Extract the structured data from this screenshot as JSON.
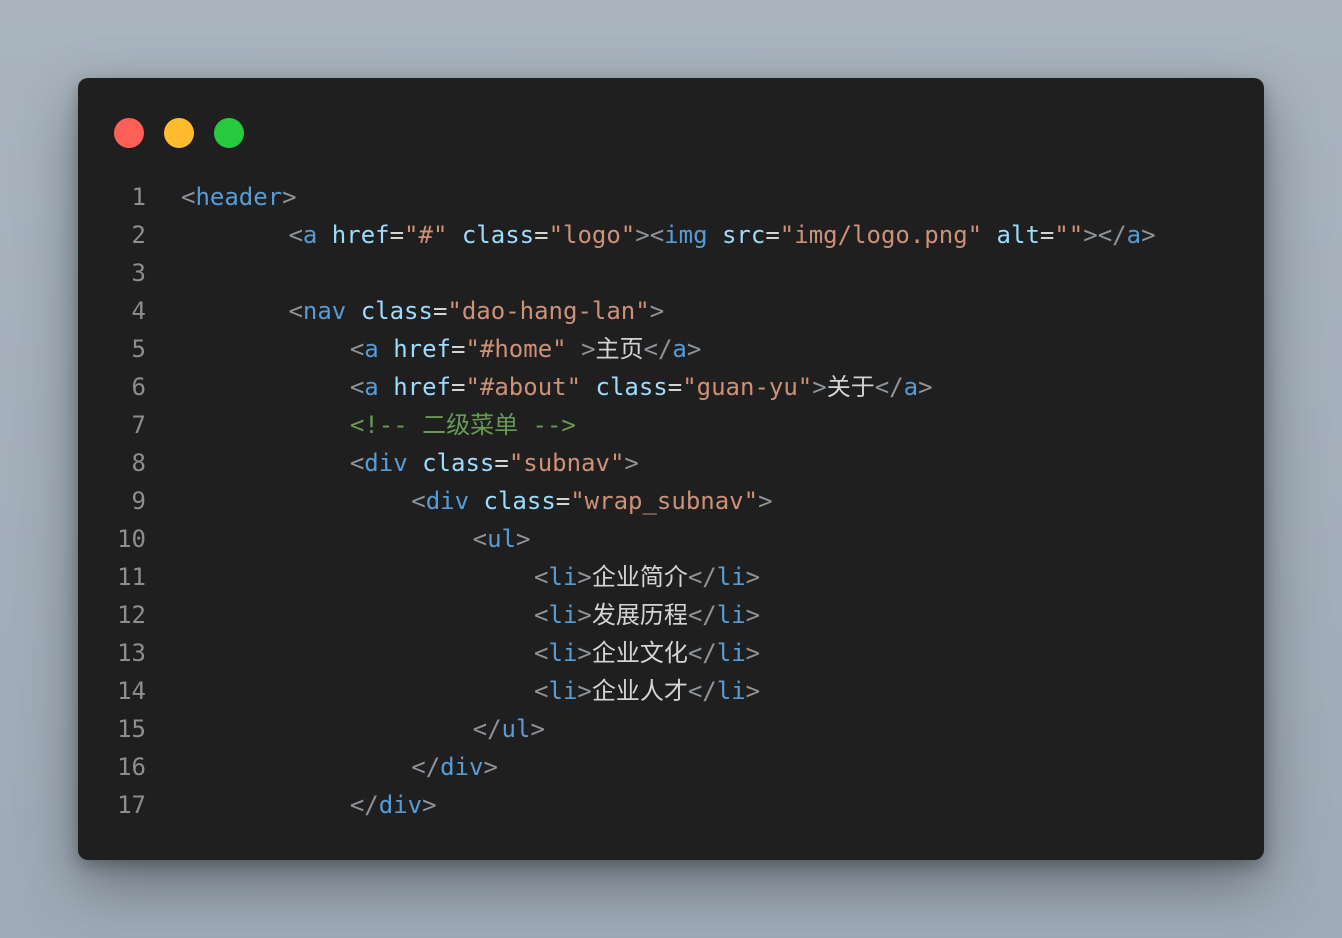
{
  "window_controls": [
    {
      "name": "close",
      "color": "#ff5f56"
    },
    {
      "name": "minimize",
      "color": "#ffbd2e"
    },
    {
      "name": "maximize",
      "color": "#27c93f"
    }
  ],
  "colors": {
    "bracket": "#8e9499",
    "tag": "#569cd6",
    "attr": "#9cdcfe",
    "string": "#ce9178",
    "text": "#d4d4d4",
    "comment": "#6a9955"
  },
  "code": {
    "lines": [
      {
        "n": "1",
        "indent": 0,
        "tokens": [
          {
            "t": "<",
            "k": "bracket"
          },
          {
            "t": "header",
            "k": "tag"
          },
          {
            "t": ">",
            "k": "bracket"
          }
        ]
      },
      {
        "n": "2",
        "indent": 7,
        "tokens": [
          {
            "t": "<",
            "k": "bracket"
          },
          {
            "t": "a",
            "k": "tag"
          },
          {
            "t": " ",
            "k": "text"
          },
          {
            "t": "href",
            "k": "attr"
          },
          {
            "t": "=",
            "k": "text"
          },
          {
            "t": "\"#\"",
            "k": "string"
          },
          {
            "t": " ",
            "k": "text"
          },
          {
            "t": "class",
            "k": "attr"
          },
          {
            "t": "=",
            "k": "text"
          },
          {
            "t": "\"logo\"",
            "k": "string"
          },
          {
            "t": "><",
            "k": "bracket"
          },
          {
            "t": "img",
            "k": "tag"
          },
          {
            "t": " ",
            "k": "text"
          },
          {
            "t": "src",
            "k": "attr"
          },
          {
            "t": "=",
            "k": "text"
          },
          {
            "t": "\"img/logo.png\"",
            "k": "string"
          },
          {
            "t": " ",
            "k": "text"
          },
          {
            "t": "alt",
            "k": "attr"
          },
          {
            "t": "=",
            "k": "text"
          },
          {
            "t": "\"\"",
            "k": "string"
          },
          {
            "t": "></",
            "k": "bracket"
          },
          {
            "t": "a",
            "k": "tag"
          },
          {
            "t": ">",
            "k": "bracket"
          }
        ]
      },
      {
        "n": "3",
        "indent": 0,
        "tokens": []
      },
      {
        "n": "4",
        "indent": 7,
        "tokens": [
          {
            "t": "<",
            "k": "bracket"
          },
          {
            "t": "nav",
            "k": "tag"
          },
          {
            "t": " ",
            "k": "text"
          },
          {
            "t": "class",
            "k": "attr"
          },
          {
            "t": "=",
            "k": "text"
          },
          {
            "t": "\"dao-hang-lan\"",
            "k": "string"
          },
          {
            "t": ">",
            "k": "bracket"
          }
        ]
      },
      {
        "n": "5",
        "indent": 11,
        "tokens": [
          {
            "t": "<",
            "k": "bracket"
          },
          {
            "t": "a",
            "k": "tag"
          },
          {
            "t": " ",
            "k": "text"
          },
          {
            "t": "href",
            "k": "attr"
          },
          {
            "t": "=",
            "k": "text"
          },
          {
            "t": "\"#home\"",
            "k": "string"
          },
          {
            "t": " ",
            "k": "text"
          },
          {
            "t": ">",
            "k": "bracket"
          },
          {
            "t": "主页",
            "k": "text"
          },
          {
            "t": "</",
            "k": "bracket"
          },
          {
            "t": "a",
            "k": "tag"
          },
          {
            "t": ">",
            "k": "bracket"
          }
        ]
      },
      {
        "n": "6",
        "indent": 11,
        "tokens": [
          {
            "t": "<",
            "k": "bracket"
          },
          {
            "t": "a",
            "k": "tag"
          },
          {
            "t": " ",
            "k": "text"
          },
          {
            "t": "href",
            "k": "attr"
          },
          {
            "t": "=",
            "k": "text"
          },
          {
            "t": "\"#about\"",
            "k": "string"
          },
          {
            "t": " ",
            "k": "text"
          },
          {
            "t": "class",
            "k": "attr"
          },
          {
            "t": "=",
            "k": "text"
          },
          {
            "t": "\"guan-yu\"",
            "k": "string"
          },
          {
            "t": ">",
            "k": "bracket"
          },
          {
            "t": "关于",
            "k": "text"
          },
          {
            "t": "</",
            "k": "bracket"
          },
          {
            "t": "a",
            "k": "tag"
          },
          {
            "t": ">",
            "k": "bracket"
          }
        ]
      },
      {
        "n": "7",
        "indent": 11,
        "tokens": [
          {
            "t": "<!-- 二级菜单 -->",
            "k": "comment"
          }
        ]
      },
      {
        "n": "8",
        "indent": 11,
        "tokens": [
          {
            "t": "<",
            "k": "bracket"
          },
          {
            "t": "div",
            "k": "tag"
          },
          {
            "t": " ",
            "k": "text"
          },
          {
            "t": "class",
            "k": "attr"
          },
          {
            "t": "=",
            "k": "text"
          },
          {
            "t": "\"subnav\"",
            "k": "string"
          },
          {
            "t": ">",
            "k": "bracket"
          }
        ]
      },
      {
        "n": "9",
        "indent": 15,
        "tokens": [
          {
            "t": "<",
            "k": "bracket"
          },
          {
            "t": "div",
            "k": "tag"
          },
          {
            "t": " ",
            "k": "text"
          },
          {
            "t": "class",
            "k": "attr"
          },
          {
            "t": "=",
            "k": "text"
          },
          {
            "t": "\"wrap_subnav\"",
            "k": "string"
          },
          {
            "t": ">",
            "k": "bracket"
          }
        ]
      },
      {
        "n": "10",
        "indent": 19,
        "tokens": [
          {
            "t": "<",
            "k": "bracket"
          },
          {
            "t": "ul",
            "k": "tag"
          },
          {
            "t": ">",
            "k": "bracket"
          }
        ]
      },
      {
        "n": "11",
        "indent": 23,
        "tokens": [
          {
            "t": "<",
            "k": "bracket"
          },
          {
            "t": "li",
            "k": "tag"
          },
          {
            "t": ">",
            "k": "bracket"
          },
          {
            "t": "企业简介",
            "k": "text"
          },
          {
            "t": "</",
            "k": "bracket"
          },
          {
            "t": "li",
            "k": "tag"
          },
          {
            "t": ">",
            "k": "bracket"
          }
        ]
      },
      {
        "n": "12",
        "indent": 23,
        "tokens": [
          {
            "t": "<",
            "k": "bracket"
          },
          {
            "t": "li",
            "k": "tag"
          },
          {
            "t": ">",
            "k": "bracket"
          },
          {
            "t": "发展历程",
            "k": "text"
          },
          {
            "t": "</",
            "k": "bracket"
          },
          {
            "t": "li",
            "k": "tag"
          },
          {
            "t": ">",
            "k": "bracket"
          }
        ]
      },
      {
        "n": "13",
        "indent": 23,
        "tokens": [
          {
            "t": "<",
            "k": "bracket"
          },
          {
            "t": "li",
            "k": "tag"
          },
          {
            "t": ">",
            "k": "bracket"
          },
          {
            "t": "企业文化",
            "k": "text"
          },
          {
            "t": "</",
            "k": "bracket"
          },
          {
            "t": "li",
            "k": "tag"
          },
          {
            "t": ">",
            "k": "bracket"
          }
        ]
      },
      {
        "n": "14",
        "indent": 23,
        "tokens": [
          {
            "t": "<",
            "k": "bracket"
          },
          {
            "t": "li",
            "k": "tag"
          },
          {
            "t": ">",
            "k": "bracket"
          },
          {
            "t": "企业人才",
            "k": "text"
          },
          {
            "t": "</",
            "k": "bracket"
          },
          {
            "t": "li",
            "k": "tag"
          },
          {
            "t": ">",
            "k": "bracket"
          }
        ]
      },
      {
        "n": "15",
        "indent": 19,
        "tokens": [
          {
            "t": "</",
            "k": "bracket"
          },
          {
            "t": "ul",
            "k": "tag"
          },
          {
            "t": ">",
            "k": "bracket"
          }
        ]
      },
      {
        "n": "16",
        "indent": 15,
        "tokens": [
          {
            "t": "</",
            "k": "bracket"
          },
          {
            "t": "div",
            "k": "tag"
          },
          {
            "t": ">",
            "k": "bracket"
          }
        ]
      },
      {
        "n": "17",
        "indent": 11,
        "tokens": [
          {
            "t": "</",
            "k": "bracket"
          },
          {
            "t": "div",
            "k": "tag"
          },
          {
            "t": ">",
            "k": "bracket"
          }
        ]
      }
    ]
  }
}
